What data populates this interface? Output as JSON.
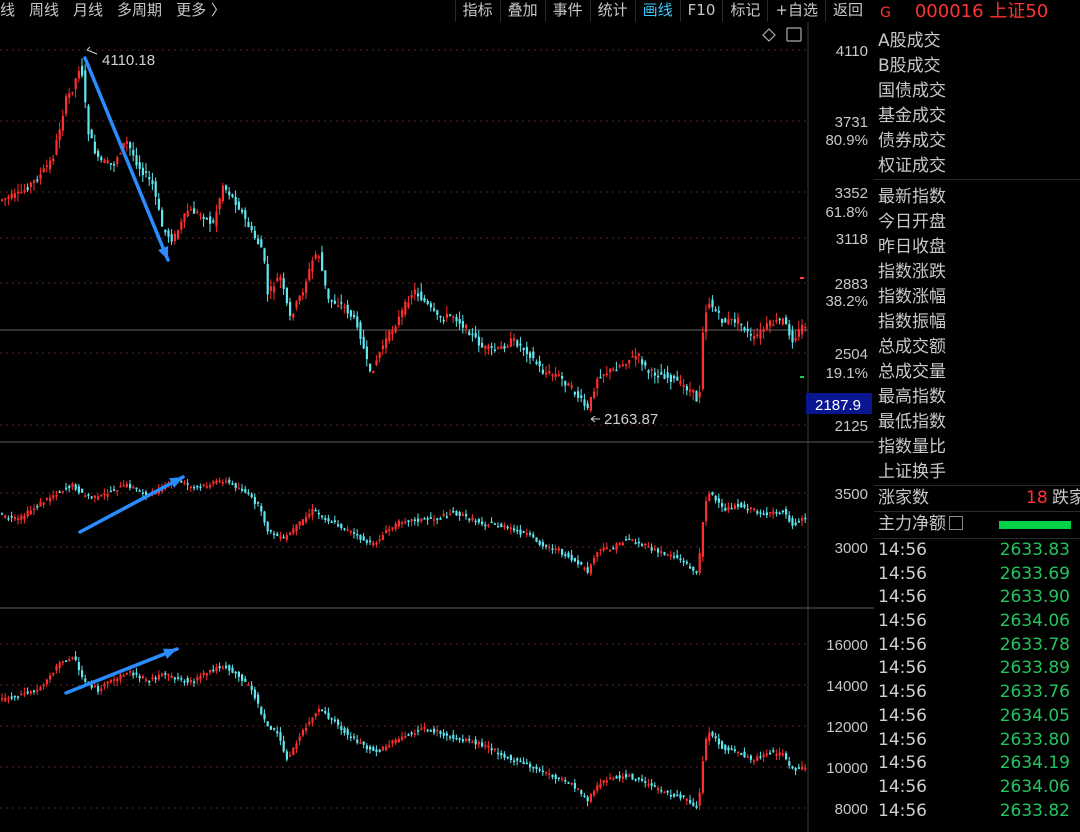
{
  "toolbar": {
    "left": [
      "线",
      "周线",
      "月线",
      "多周期",
      "更多 〉"
    ],
    "right": [
      "指标",
      "叠加",
      "事件",
      "统计",
      "画线",
      "F10",
      "标记",
      "+自选",
      "返回"
    ],
    "active": "画线"
  },
  "main_axis": {
    "ticks": [
      "4110",
      "3731",
      "3352",
      "3118",
      "2883",
      "2504",
      "2125"
    ],
    "pct": [
      "80.9%",
      "61.8%",
      "38.2%",
      "19.1%"
    ],
    "current": "2187.9"
  },
  "annotations": {
    "high": "4110.18",
    "low": "2163.87"
  },
  "panel2_axis": [
    "3500",
    "3000"
  ],
  "panel3_axis": [
    "16000",
    "14000",
    "12000",
    "10000",
    "8000"
  ],
  "side": {
    "g": "G",
    "code": "000016",
    "name": "上证50",
    "labels_a": [
      "A股成交",
      " B股成交",
      "国债成交",
      "基金成交",
      "债券成交",
      "权证成交"
    ],
    "labels_b": [
      "最新指数",
      "今日开盘",
      "昨日收盘",
      "指数涨跌",
      "指数涨幅",
      "指数振幅",
      "总成交额",
      "总成交量",
      "最高指数",
      "最低指数",
      "指数量比",
      "上证换手"
    ],
    "zhang_label": "涨家数",
    "zhang_num": "18",
    "die_label": "跌家",
    "main_label": "主力净额",
    "ticks": [
      {
        "t": "14:56",
        "p": "2633.83"
      },
      {
        "t": "14:56",
        "p": "2633.69"
      },
      {
        "t": "14:56",
        "p": "2633.90"
      },
      {
        "t": "14:56",
        "p": "2634.06"
      },
      {
        "t": "14:56",
        "p": "2633.78"
      },
      {
        "t": "14:56",
        "p": "2633.89"
      },
      {
        "t": "14:56",
        "p": "2633.76"
      },
      {
        "t": "14:56",
        "p": "2634.05"
      },
      {
        "t": "14:56",
        "p": "2633.80"
      },
      {
        "t": "14:56",
        "p": "2634.19"
      },
      {
        "t": "14:56",
        "p": "2634.06"
      },
      {
        "t": "14:56",
        "p": "2633.82"
      }
    ]
  },
  "colors": {
    "up": "#ff2d2d",
    "down": "#5fe6ee",
    "arrow": "#2a8cff",
    "accent": "#3cc9ff",
    "green": "#22c55e"
  }
}
